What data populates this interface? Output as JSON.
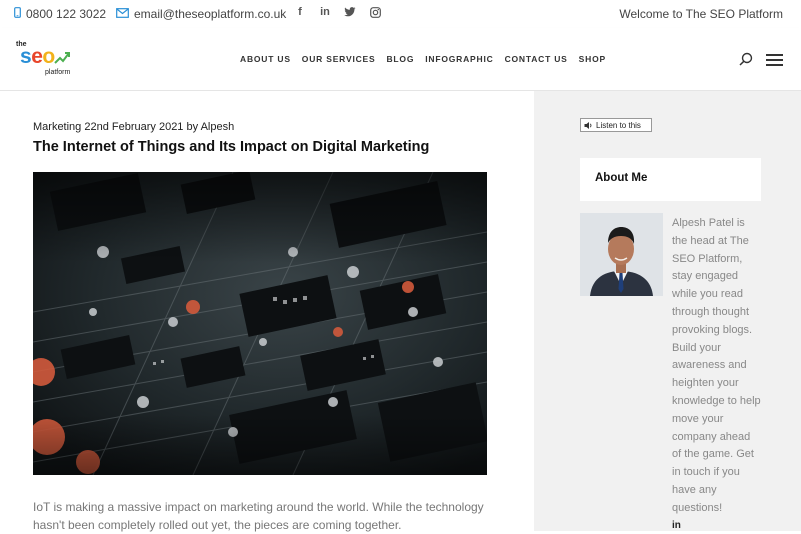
{
  "topbar": {
    "phone": "0800 122 3022",
    "email": "email@theseoplatform.co.uk",
    "social_icons": [
      "facebook-icon",
      "linkedin-icon",
      "twitter-icon",
      "instagram-icon"
    ],
    "welcome": "Welcome to The SEO Platform"
  },
  "logo": {
    "top": "the",
    "main": "seo",
    "bottom": "platform"
  },
  "nav": {
    "items": [
      "ABOUT US",
      "OUR SERVICES",
      "BLOG",
      "INFOGRAPHIC",
      "CONTACT US",
      "SHOP"
    ]
  },
  "post": {
    "category": "Marketing",
    "date": "22nd February 2021",
    "by": "by",
    "author": "Alpesh",
    "title": "The Internet of Things and Its Impact on Digital Marketing",
    "excerpt": "IoT is making a massive impact on marketing around the world. While the technology hasn't been completely rolled out yet, the pieces are coming together."
  },
  "sidebar": {
    "listen_label": "Listen to this",
    "about_title": "About Me",
    "bio": "Alpesh Patel is the head at The SEO Platform, stay engaged while you read through thought provoking blogs. Build your awareness and heighten your knowledge to help move your company ahead of the game. Get in touch if you have any questions!",
    "linkedin_label": "in"
  },
  "colors": {
    "accent_blue": "#2a8fd6",
    "sidebar_bg": "#f1f1f1"
  }
}
